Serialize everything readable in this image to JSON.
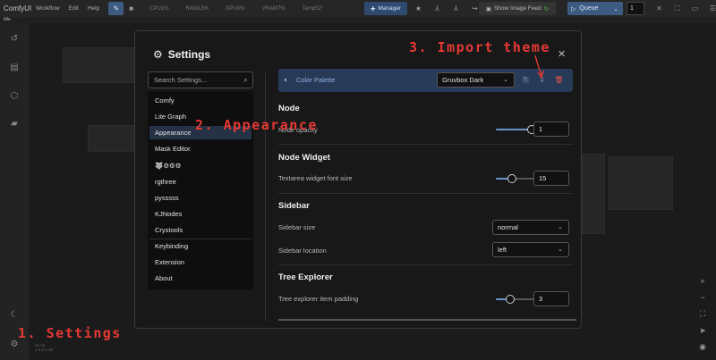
{
  "app": {
    "brand": "ComfyUI",
    "menu": [
      "Workflow",
      "Edit",
      "Help"
    ],
    "stats": [
      "CPU1%",
      "RAM13%",
      "GPU0%",
      "VRAM7%",
      "Temp52°"
    ],
    "manager_label": "Manager",
    "feed_label": "Show Image Feed",
    "queue_label": "Queue",
    "queue_count": "1",
    "tab_title": "title",
    "version_lines": [
      "v1.16",
      "1.2.0:1.16"
    ]
  },
  "settings": {
    "title": "Settings",
    "search_placeholder": "Search Settings...",
    "categories": [
      "Comfy",
      "Lite Graph",
      "Appearance",
      "Mask Editor",
      "🐺⚙⚙⚙",
      "rgthree",
      "pysssss",
      "KJNodes",
      "Crystools",
      "Keybinding",
      "Extension",
      "About"
    ],
    "selected_category": "Appearance",
    "palette": {
      "label": "Color Palette",
      "selected": "Gruvbox Dark"
    },
    "sections": {
      "node": {
        "title": "Node",
        "opacity_label": "Node opacity",
        "opacity_value": "1",
        "opacity_fraction": 1.0
      },
      "node_widget": {
        "title": "Node Widget",
        "font_label": "Textarea widget font size",
        "font_value": "15",
        "font_fraction": 0.4
      },
      "sidebar": {
        "title": "Sidebar",
        "size_label": "Sidebar size",
        "size_value": "normal",
        "location_label": "Sidebar location",
        "location_value": "left"
      },
      "tree_explorer": {
        "title": "Tree Explorer",
        "padding_label": "Tree explorer item padding",
        "padding_value": "3",
        "padding_fraction": 0.33
      }
    }
  },
  "annotations": {
    "settings": "1. Settings",
    "appearance": "2. Appearance",
    "import_theme": "3. Import theme"
  },
  "colors": {
    "accent": "#3d5a80",
    "annotation": "#e53935",
    "delete": "#e05252"
  }
}
